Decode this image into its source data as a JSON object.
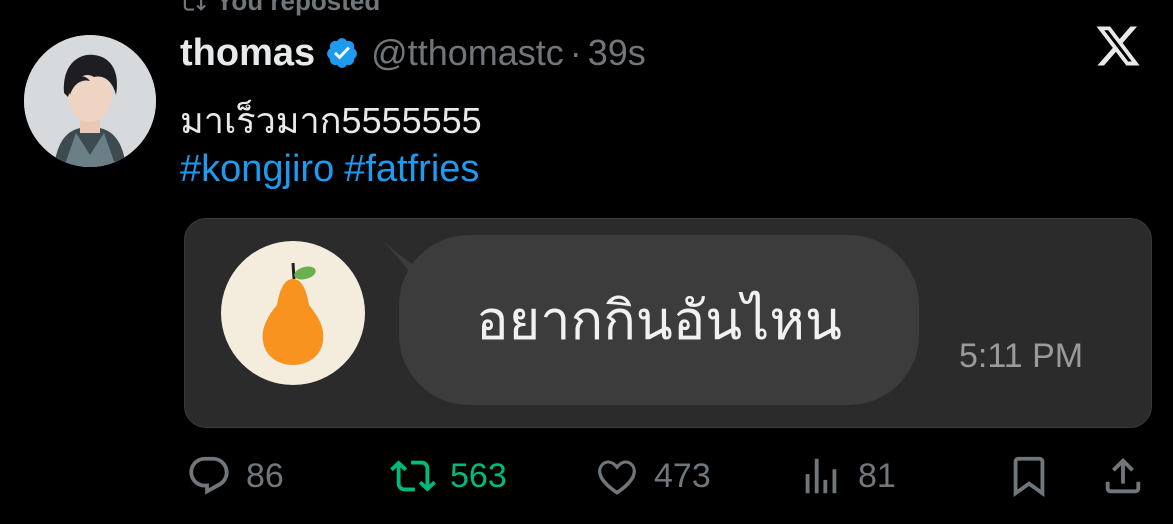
{
  "repost_banner": {
    "label": "You reposted"
  },
  "tweet": {
    "author_name": "thomas",
    "handle": "@tthomastc",
    "separator": "·",
    "timestamp": "39s",
    "text": "มาเร็วมาก5555555",
    "hashtags": [
      "#kongjiro",
      "#fatfries"
    ]
  },
  "media": {
    "chat_message": "อยากกินอันไหน",
    "chat_time": "5:11 PM"
  },
  "actions": {
    "replies": "86",
    "reposts": "563",
    "likes": "473",
    "views": "81"
  },
  "colors": {
    "background": "#000000",
    "accent": "#1d9bf0",
    "muted": "#71767b",
    "repost_active": "#00ba7c",
    "pear": "#f7931e"
  },
  "icons": [
    "x-logo-icon",
    "verified-icon",
    "reply-icon",
    "repost-icon",
    "like-icon",
    "views-icon",
    "bookmark-icon",
    "share-icon"
  ]
}
